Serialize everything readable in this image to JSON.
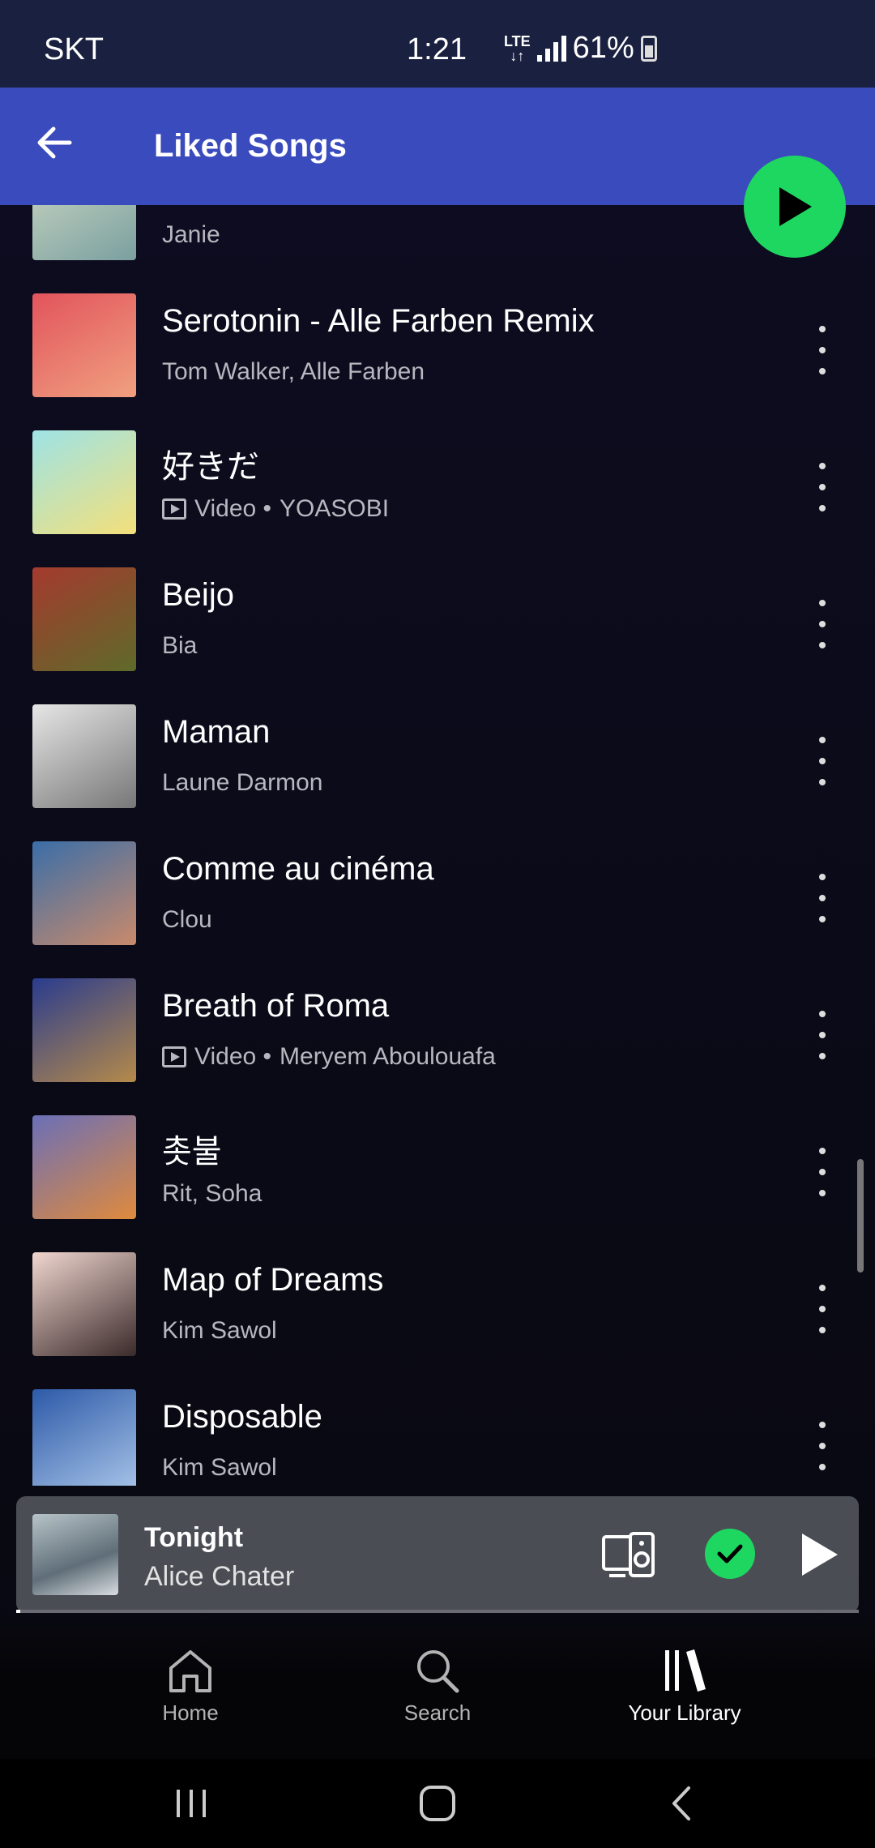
{
  "status": {
    "carrier": "SKT",
    "time": "1:21",
    "network": "LTE",
    "battery": "61%"
  },
  "header": {
    "title": "Liked Songs"
  },
  "songs": [
    {
      "title": "",
      "subtitle": "Janie",
      "video": false,
      "colors": [
        "#cfd9c4",
        "#7aa0a0"
      ]
    },
    {
      "title": "Serotonin - Alle Farben Remix",
      "subtitle": "Tom Walker, Alle Farben",
      "video": false,
      "colors": [
        "#e2545c",
        "#f0a080"
      ]
    },
    {
      "title": "好きだ",
      "subtitle": "YOASOBI",
      "video": true,
      "colors": [
        "#9ee3e6",
        "#f3e07a"
      ]
    },
    {
      "title": "Beijo",
      "subtitle": "Bia",
      "video": false,
      "colors": [
        "#a53a2e",
        "#5e6a2a"
      ]
    },
    {
      "title": "Maman",
      "subtitle": "Laune Darmon",
      "video": false,
      "colors": [
        "#e6e6e6",
        "#777777"
      ]
    },
    {
      "title": "Comme au cinéma",
      "subtitle": "Clou",
      "video": false,
      "colors": [
        "#3a6ea8",
        "#c98a6b"
      ]
    },
    {
      "title": "Breath of Roma",
      "subtitle": "Meryem Aboulouafa",
      "video": true,
      "colors": [
        "#2a3c8e",
        "#b58a4a"
      ]
    },
    {
      "title": "촛불",
      "subtitle": "Rit, Soha",
      "video": false,
      "colors": [
        "#6a6fb8",
        "#e08a3c"
      ]
    },
    {
      "title": "Map of Dreams",
      "subtitle": "Kim Sawol",
      "video": false,
      "colors": [
        "#f0d6cf",
        "#3a2a2a"
      ]
    },
    {
      "title": "Disposable",
      "subtitle": "Kim Sawol",
      "video": false,
      "colors": [
        "#2d5aa8",
        "#a8c4e8"
      ]
    }
  ],
  "video_label": "Video •",
  "now_playing": {
    "title": "Tonight",
    "artist": "Alice Chater",
    "progress": 0.005
  },
  "nav": {
    "home": "Home",
    "search": "Search",
    "library": "Your Library"
  },
  "colors": {
    "accent": "#1ed760",
    "header": "#3a4bbd"
  }
}
